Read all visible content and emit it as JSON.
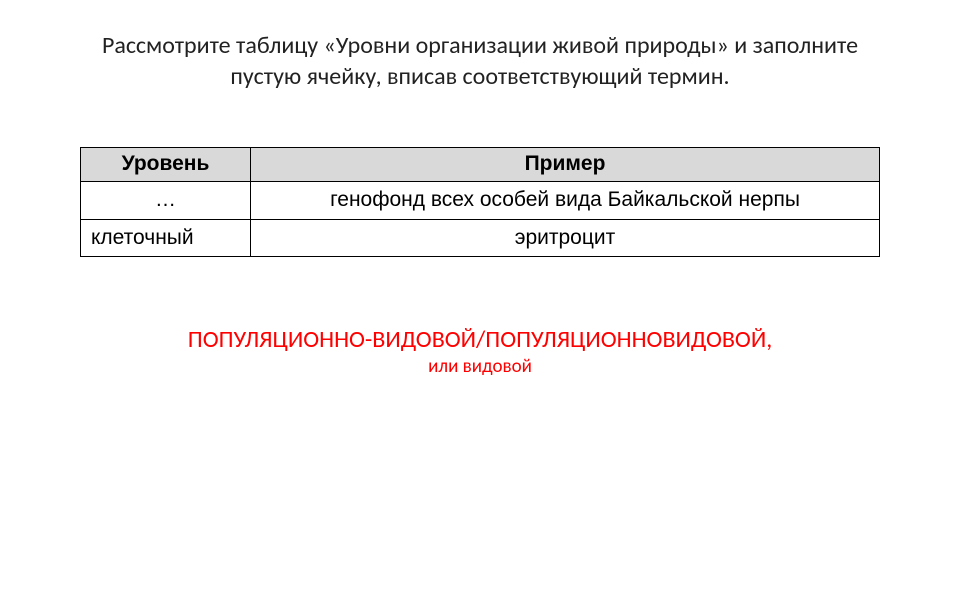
{
  "prompt": {
    "line1": "Рассмотрите таблицу «Уровни организации живой природы» и заполните",
    "line2": "пустую ячейку, вписав соответствующий термин."
  },
  "table": {
    "headers": {
      "level": "Уровень",
      "example": "Пример"
    },
    "rows": [
      {
        "level": "…",
        "example": "генофонд всех особей вида Байкальской нерпы"
      },
      {
        "level": "клеточный",
        "example": "эритроцит"
      }
    ]
  },
  "answer": {
    "line1": "ПОПУЛЯЦИОННО-ВИДОВОЙ/ПОПУЛЯЦИОННОВИДОВОЙ,",
    "line2": "или видовой"
  }
}
